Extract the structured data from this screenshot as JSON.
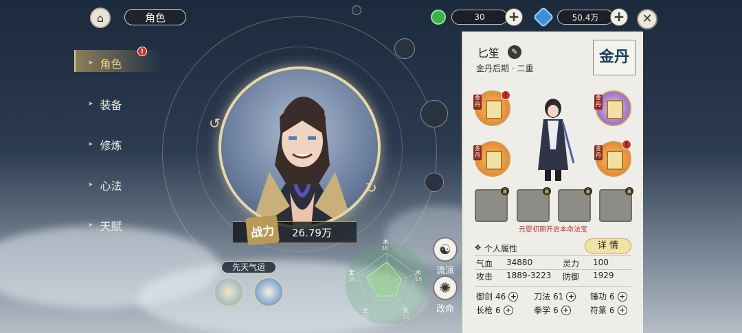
{
  "header": {
    "title": "角色"
  },
  "resources": [
    {
      "icon": "green-jade-icon",
      "value": "30",
      "color": "#3cae4c"
    },
    {
      "icon": "blue-spirit-stone-icon",
      "value": "50.4万",
      "color": "#3d8fd8"
    }
  ],
  "menu": {
    "items": [
      {
        "label": "角色",
        "selected": true,
        "badge": "!"
      },
      {
        "label": "装备"
      },
      {
        "label": "修炼"
      },
      {
        "label": "心法"
      },
      {
        "label": "天赋"
      }
    ]
  },
  "character": {
    "power_label": "战力",
    "power_value": "26.79万",
    "innate_luck_label": "先天气运"
  },
  "side_buttons": [
    {
      "label": "流派",
      "icon": "sect-icon"
    },
    {
      "label": "改命",
      "icon": "fate-icon"
    }
  ],
  "radar": {
    "labels": [
      {
        "name": "木",
        "value": "36"
      },
      {
        "name": "水",
        "value": "18"
      },
      {
        "name": "火",
        "value": "16"
      },
      {
        "name": "土",
        "value": "16"
      },
      {
        "name": "金",
        "value": "36"
      }
    ]
  },
  "panel": {
    "name": "匕笙",
    "stage": "金丹后期 · 二重",
    "rank": "金丹",
    "slot_tag": "金丹",
    "locked_hint": "元婴初期开启本命法宝",
    "attributes_title": "个人属性",
    "detail_button": "详 情",
    "stats": [
      {
        "label": "气血",
        "value": "34880"
      },
      {
        "label": "灵力",
        "value": "100"
      },
      {
        "label": "攻击",
        "value": "1889-3223"
      },
      {
        "label": "防御",
        "value": "1929"
      }
    ],
    "skills": [
      {
        "label": "御剑",
        "value": "46"
      },
      {
        "label": "刀法",
        "value": "61"
      },
      {
        "label": "锤功",
        "value": "6"
      },
      {
        "label": "长枪",
        "value": "6"
      },
      {
        "label": "拳学",
        "value": "6"
      },
      {
        "label": "符篆",
        "value": "6"
      }
    ]
  }
}
